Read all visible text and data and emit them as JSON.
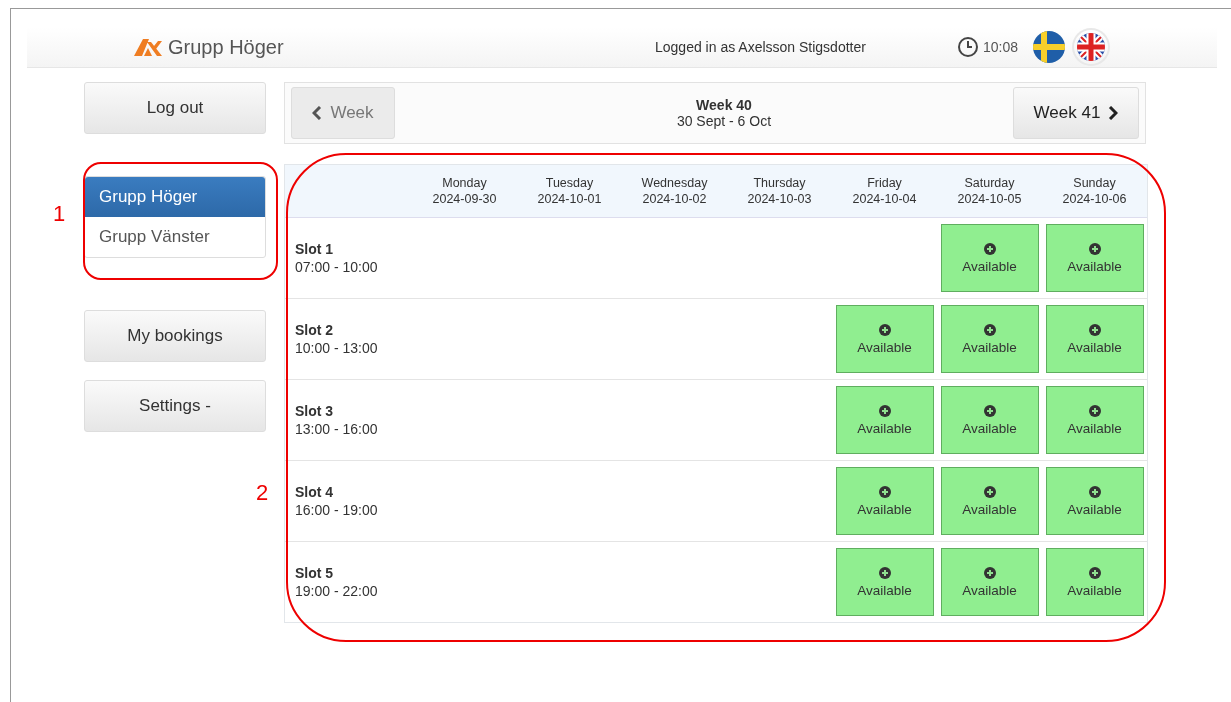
{
  "header": {
    "brand": "Grupp Höger",
    "logged_in": "Logged in as Axelsson Stigsdotter",
    "time": "10:08",
    "languages": [
      {
        "kind": "sv",
        "selected": false
      },
      {
        "kind": "en",
        "selected": true
      }
    ]
  },
  "sidebar": {
    "logout": "Log out",
    "groups": [
      {
        "label": "Grupp Höger",
        "selected": true
      },
      {
        "label": "Grupp Vänster",
        "selected": false
      }
    ],
    "buttons": [
      {
        "label": "My bookings",
        "kind": "plain"
      },
      {
        "label": "Settings",
        "kind": "dropdown",
        "caret": "-"
      }
    ]
  },
  "week_nav": {
    "previous": "Week",
    "title": "Week 40",
    "range": "30 Sept - 6 Oct",
    "next": "Week 41"
  },
  "table": {
    "columns": [
      {
        "day": "Monday",
        "date": "2024-09-30"
      },
      {
        "day": "Tuesday",
        "date": "2024-10-01"
      },
      {
        "day": "Wednesday",
        "date": "2024-10-02"
      },
      {
        "day": "Thursday",
        "date": "2024-10-03"
      },
      {
        "day": "Friday",
        "date": "2024-10-04"
      },
      {
        "day": "Saturday",
        "date": "2024-10-05"
      },
      {
        "day": "Sunday",
        "date": "2024-10-06"
      }
    ],
    "rows": [
      {
        "slot": "Slot 1",
        "time": "07:00 - 10:00",
        "cells": [
          {
            "kind": "empty"
          },
          {
            "kind": "empty"
          },
          {
            "kind": "empty"
          },
          {
            "kind": "empty"
          },
          {
            "kind": "empty"
          },
          {
            "kind": "available",
            "label": "Available"
          },
          {
            "kind": "available",
            "label": "Available"
          }
        ]
      },
      {
        "slot": "Slot 2",
        "time": "10:00 - 13:00",
        "cells": [
          {
            "kind": "empty"
          },
          {
            "kind": "empty"
          },
          {
            "kind": "empty"
          },
          {
            "kind": "empty"
          },
          {
            "kind": "available",
            "label": "Available"
          },
          {
            "kind": "available",
            "label": "Available"
          },
          {
            "kind": "available",
            "label": "Available"
          }
        ]
      },
      {
        "slot": "Slot 3",
        "time": "13:00 - 16:00",
        "cells": [
          {
            "kind": "empty"
          },
          {
            "kind": "empty"
          },
          {
            "kind": "empty"
          },
          {
            "kind": "empty"
          },
          {
            "kind": "available",
            "label": "Available"
          },
          {
            "kind": "available",
            "label": "Available"
          },
          {
            "kind": "available",
            "label": "Available"
          }
        ]
      },
      {
        "slot": "Slot 4",
        "time": "16:00 - 19:00",
        "cells": [
          {
            "kind": "empty"
          },
          {
            "kind": "empty"
          },
          {
            "kind": "empty"
          },
          {
            "kind": "empty"
          },
          {
            "kind": "available",
            "label": "Available"
          },
          {
            "kind": "available",
            "label": "Available"
          },
          {
            "kind": "available",
            "label": "Available"
          }
        ]
      },
      {
        "slot": "Slot 5",
        "time": "19:00 - 22:00",
        "cells": [
          {
            "kind": "empty"
          },
          {
            "kind": "empty"
          },
          {
            "kind": "empty"
          },
          {
            "kind": "empty"
          },
          {
            "kind": "available",
            "label": "Available"
          },
          {
            "kind": "available",
            "label": "Available"
          },
          {
            "kind": "available",
            "label": "Available"
          }
        ]
      }
    ]
  },
  "annotations": [
    {
      "label": "1",
      "kind": "groups"
    },
    {
      "label": "2",
      "kind": "table"
    }
  ]
}
